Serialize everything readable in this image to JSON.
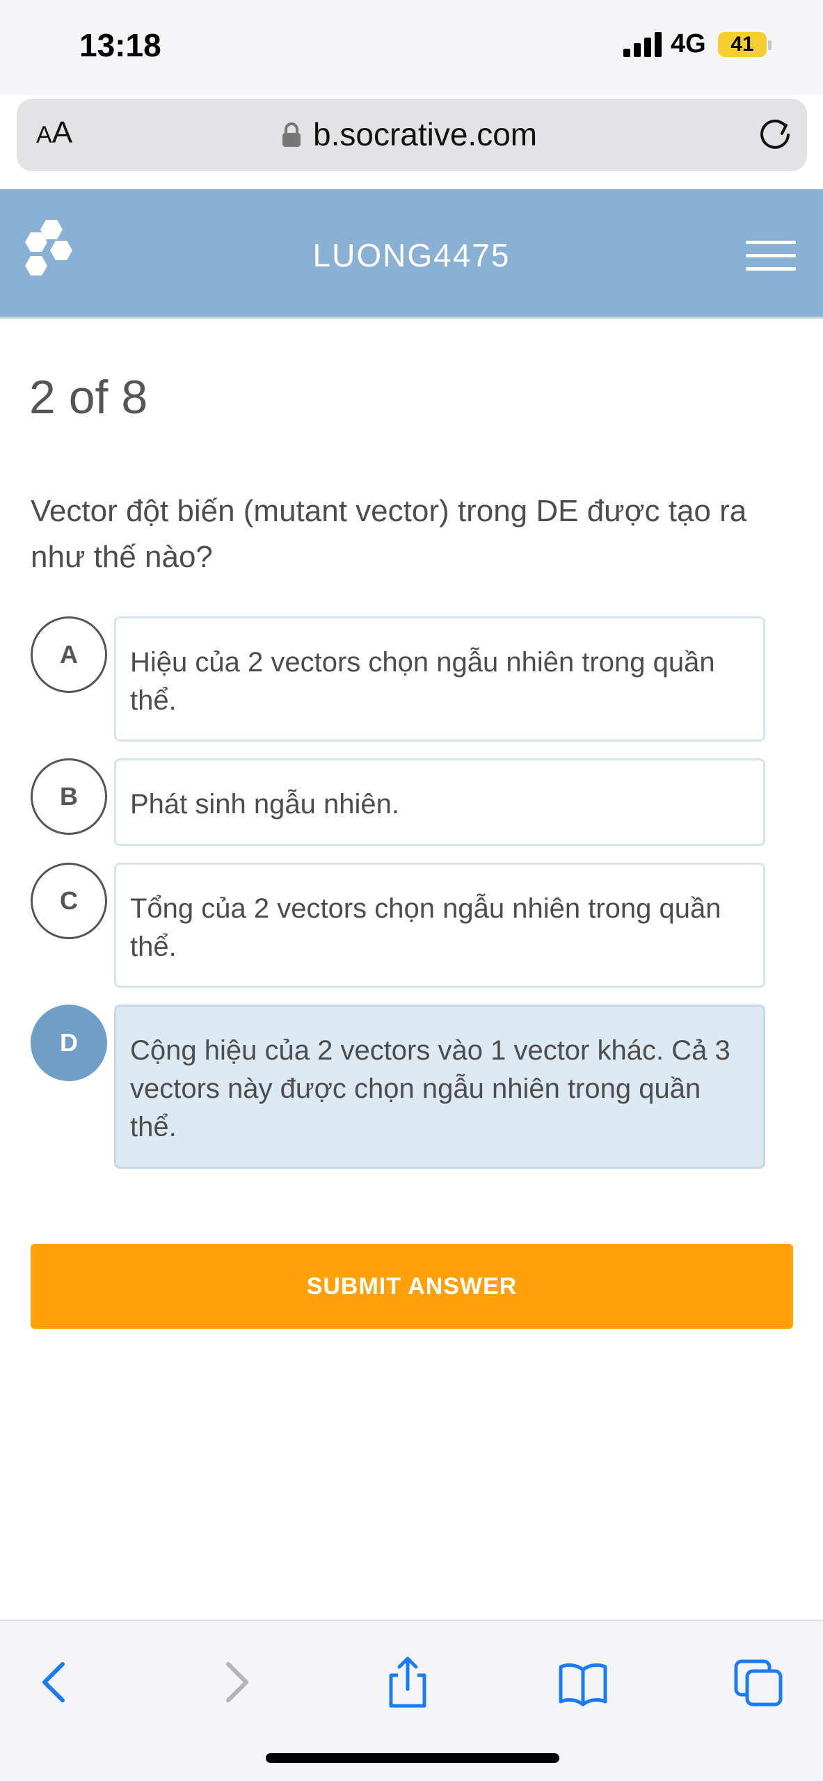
{
  "status_bar": {
    "time": "13:18",
    "network": "4G",
    "battery": "41"
  },
  "browser": {
    "aa_label_small": "A",
    "aa_label_large": "A",
    "url": "b.socrative.com"
  },
  "header": {
    "room_name": "LUONG4475"
  },
  "quiz": {
    "progress": "2 of 8",
    "question": "Vector đột biến (mutant vector) trong DE được tạo ra như thế nào?",
    "options": [
      {
        "letter": "A",
        "text": "Hiệu của 2 vectors chọn ngẫu nhiên trong quần thể.",
        "selected": false
      },
      {
        "letter": "B",
        "text": "Phát sinh ngẫu nhiên.",
        "selected": false
      },
      {
        "letter": "C",
        "text": "Tổng của 2 vectors chọn ngẫu nhiên trong quần thể.",
        "selected": false
      },
      {
        "letter": "D",
        "text": "Cộng hiệu của 2 vectors vào 1 vector khác. Cả 3 vectors này được chọn ngẫu nhiên trong quần thể.",
        "selected": true
      }
    ],
    "submit_label": "SUBMIT ANSWER"
  },
  "colors": {
    "header_bg": "#8ab1d3",
    "selected_circle": "#6f9ec6",
    "selected_box": "#dde9f3",
    "submit": "#ffa10a",
    "safari_blue": "#1a7cf5"
  }
}
